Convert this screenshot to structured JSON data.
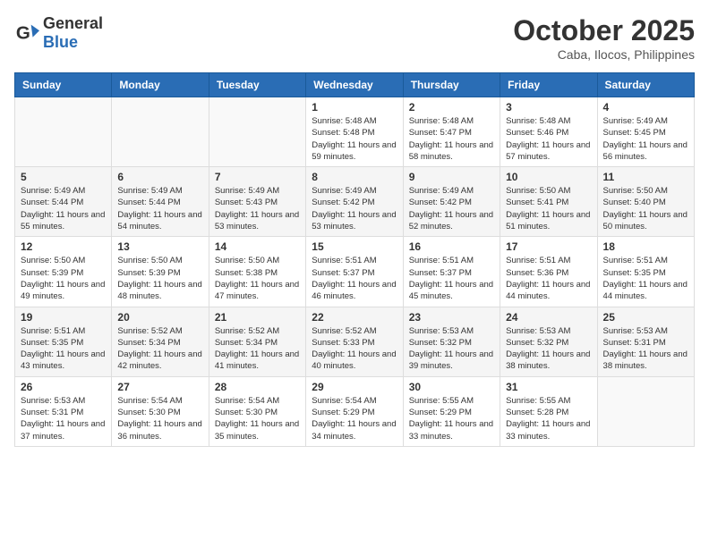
{
  "header": {
    "logo_general": "General",
    "logo_blue": "Blue",
    "month": "October 2025",
    "location": "Caba, Ilocos, Philippines"
  },
  "weekdays": [
    "Sunday",
    "Monday",
    "Tuesday",
    "Wednesday",
    "Thursday",
    "Friday",
    "Saturday"
  ],
  "rows": [
    [
      {
        "day": "",
        "sunrise": "",
        "sunset": "",
        "daylight": ""
      },
      {
        "day": "",
        "sunrise": "",
        "sunset": "",
        "daylight": ""
      },
      {
        "day": "",
        "sunrise": "",
        "sunset": "",
        "daylight": ""
      },
      {
        "day": "1",
        "sunrise": "Sunrise: 5:48 AM",
        "sunset": "Sunset: 5:48 PM",
        "daylight": "Daylight: 11 hours and 59 minutes."
      },
      {
        "day": "2",
        "sunrise": "Sunrise: 5:48 AM",
        "sunset": "Sunset: 5:47 PM",
        "daylight": "Daylight: 11 hours and 58 minutes."
      },
      {
        "day": "3",
        "sunrise": "Sunrise: 5:48 AM",
        "sunset": "Sunset: 5:46 PM",
        "daylight": "Daylight: 11 hours and 57 minutes."
      },
      {
        "day": "4",
        "sunrise": "Sunrise: 5:49 AM",
        "sunset": "Sunset: 5:45 PM",
        "daylight": "Daylight: 11 hours and 56 minutes."
      }
    ],
    [
      {
        "day": "5",
        "sunrise": "Sunrise: 5:49 AM",
        "sunset": "Sunset: 5:44 PM",
        "daylight": "Daylight: 11 hours and 55 minutes."
      },
      {
        "day": "6",
        "sunrise": "Sunrise: 5:49 AM",
        "sunset": "Sunset: 5:44 PM",
        "daylight": "Daylight: 11 hours and 54 minutes."
      },
      {
        "day": "7",
        "sunrise": "Sunrise: 5:49 AM",
        "sunset": "Sunset: 5:43 PM",
        "daylight": "Daylight: 11 hours and 53 minutes."
      },
      {
        "day": "8",
        "sunrise": "Sunrise: 5:49 AM",
        "sunset": "Sunset: 5:42 PM",
        "daylight": "Daylight: 11 hours and 53 minutes."
      },
      {
        "day": "9",
        "sunrise": "Sunrise: 5:49 AM",
        "sunset": "Sunset: 5:42 PM",
        "daylight": "Daylight: 11 hours and 52 minutes."
      },
      {
        "day": "10",
        "sunrise": "Sunrise: 5:50 AM",
        "sunset": "Sunset: 5:41 PM",
        "daylight": "Daylight: 11 hours and 51 minutes."
      },
      {
        "day": "11",
        "sunrise": "Sunrise: 5:50 AM",
        "sunset": "Sunset: 5:40 PM",
        "daylight": "Daylight: 11 hours and 50 minutes."
      }
    ],
    [
      {
        "day": "12",
        "sunrise": "Sunrise: 5:50 AM",
        "sunset": "Sunset: 5:39 PM",
        "daylight": "Daylight: 11 hours and 49 minutes."
      },
      {
        "day": "13",
        "sunrise": "Sunrise: 5:50 AM",
        "sunset": "Sunset: 5:39 PM",
        "daylight": "Daylight: 11 hours and 48 minutes."
      },
      {
        "day": "14",
        "sunrise": "Sunrise: 5:50 AM",
        "sunset": "Sunset: 5:38 PM",
        "daylight": "Daylight: 11 hours and 47 minutes."
      },
      {
        "day": "15",
        "sunrise": "Sunrise: 5:51 AM",
        "sunset": "Sunset: 5:37 PM",
        "daylight": "Daylight: 11 hours and 46 minutes."
      },
      {
        "day": "16",
        "sunrise": "Sunrise: 5:51 AM",
        "sunset": "Sunset: 5:37 PM",
        "daylight": "Daylight: 11 hours and 45 minutes."
      },
      {
        "day": "17",
        "sunrise": "Sunrise: 5:51 AM",
        "sunset": "Sunset: 5:36 PM",
        "daylight": "Daylight: 11 hours and 44 minutes."
      },
      {
        "day": "18",
        "sunrise": "Sunrise: 5:51 AM",
        "sunset": "Sunset: 5:35 PM",
        "daylight": "Daylight: 11 hours and 44 minutes."
      }
    ],
    [
      {
        "day": "19",
        "sunrise": "Sunrise: 5:51 AM",
        "sunset": "Sunset: 5:35 PM",
        "daylight": "Daylight: 11 hours and 43 minutes."
      },
      {
        "day": "20",
        "sunrise": "Sunrise: 5:52 AM",
        "sunset": "Sunset: 5:34 PM",
        "daylight": "Daylight: 11 hours and 42 minutes."
      },
      {
        "day": "21",
        "sunrise": "Sunrise: 5:52 AM",
        "sunset": "Sunset: 5:34 PM",
        "daylight": "Daylight: 11 hours and 41 minutes."
      },
      {
        "day": "22",
        "sunrise": "Sunrise: 5:52 AM",
        "sunset": "Sunset: 5:33 PM",
        "daylight": "Daylight: 11 hours and 40 minutes."
      },
      {
        "day": "23",
        "sunrise": "Sunrise: 5:53 AM",
        "sunset": "Sunset: 5:32 PM",
        "daylight": "Daylight: 11 hours and 39 minutes."
      },
      {
        "day": "24",
        "sunrise": "Sunrise: 5:53 AM",
        "sunset": "Sunset: 5:32 PM",
        "daylight": "Daylight: 11 hours and 38 minutes."
      },
      {
        "day": "25",
        "sunrise": "Sunrise: 5:53 AM",
        "sunset": "Sunset: 5:31 PM",
        "daylight": "Daylight: 11 hours and 38 minutes."
      }
    ],
    [
      {
        "day": "26",
        "sunrise": "Sunrise: 5:53 AM",
        "sunset": "Sunset: 5:31 PM",
        "daylight": "Daylight: 11 hours and 37 minutes."
      },
      {
        "day": "27",
        "sunrise": "Sunrise: 5:54 AM",
        "sunset": "Sunset: 5:30 PM",
        "daylight": "Daylight: 11 hours and 36 minutes."
      },
      {
        "day": "28",
        "sunrise": "Sunrise: 5:54 AM",
        "sunset": "Sunset: 5:30 PM",
        "daylight": "Daylight: 11 hours and 35 minutes."
      },
      {
        "day": "29",
        "sunrise": "Sunrise: 5:54 AM",
        "sunset": "Sunset: 5:29 PM",
        "daylight": "Daylight: 11 hours and 34 minutes."
      },
      {
        "day": "30",
        "sunrise": "Sunrise: 5:55 AM",
        "sunset": "Sunset: 5:29 PM",
        "daylight": "Daylight: 11 hours and 33 minutes."
      },
      {
        "day": "31",
        "sunrise": "Sunrise: 5:55 AM",
        "sunset": "Sunset: 5:28 PM",
        "daylight": "Daylight: 11 hours and 33 minutes."
      },
      {
        "day": "",
        "sunrise": "",
        "sunset": "",
        "daylight": ""
      }
    ]
  ]
}
